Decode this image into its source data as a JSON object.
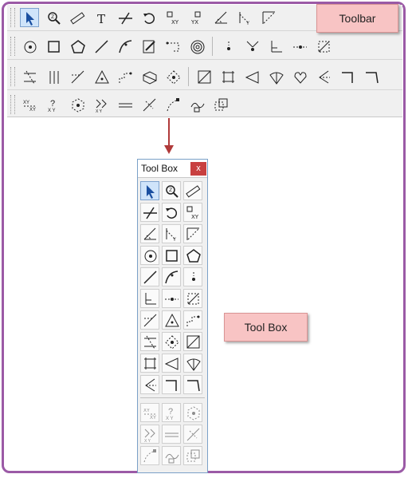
{
  "toolbar": {
    "label": "Toolbar",
    "rows": [
      [
        "select-arrow",
        "zoom",
        "ruler",
        "text",
        "break-line",
        "undo-rotate",
        "xy-swap",
        "y-swap",
        "scale-xy",
        "scale-xy-2",
        "scale-diagonal"
      ],
      [
        "circle-target",
        "square",
        "pentagon",
        "line",
        "curve-edit",
        "pencil-edit",
        "dash-shape",
        "spiral",
        "|",
        "point-snap",
        "point-down",
        "corner-axis",
        "dash-line-point",
        "dash-box"
      ],
      [
        "spread-arrows",
        "fence",
        "expand-arrows",
        "triangle-node",
        "step-node",
        "cube",
        "diamond-arrows",
        "|",
        "square-diag",
        "dash-rect",
        "triangle-left",
        "fan",
        "heart-node",
        "bracket-left",
        "corner-right",
        "corner-down"
      ],
      [
        "grid-xy",
        "help-xy",
        "hex-node",
        "arrows-xy",
        "double-line",
        "cross-line",
        "curve-node",
        "wave-box",
        "dash-squares"
      ]
    ]
  },
  "toolbox": {
    "title": "Tool Box",
    "close": "x",
    "label": "Tool Box",
    "grid": [
      "select-arrow",
      "zoom",
      "ruler",
      "break-line",
      "undo-rotate",
      "xy-swap",
      "scale-xy",
      "scale-xy-2",
      "scale-diagonal",
      "circle-target",
      "square",
      "pentagon",
      "line",
      "curve-edit",
      "point-snap",
      "corner-axis",
      "dash-line-point",
      "dash-box",
      "expand-arrows",
      "triangle-node",
      "step-node",
      "spread-arrows",
      "diamond-arrows",
      "square-diag",
      "dash-rect",
      "triangle-left",
      "fan",
      "bracket-left",
      "corner-right",
      "corner-down"
    ],
    "grid_disabled": [
      "grid-xy",
      "help-xy",
      "hex-node",
      "arrows-xy",
      "double-line",
      "cross-line",
      "curve-node",
      "wave-box",
      "dash-squares"
    ]
  }
}
